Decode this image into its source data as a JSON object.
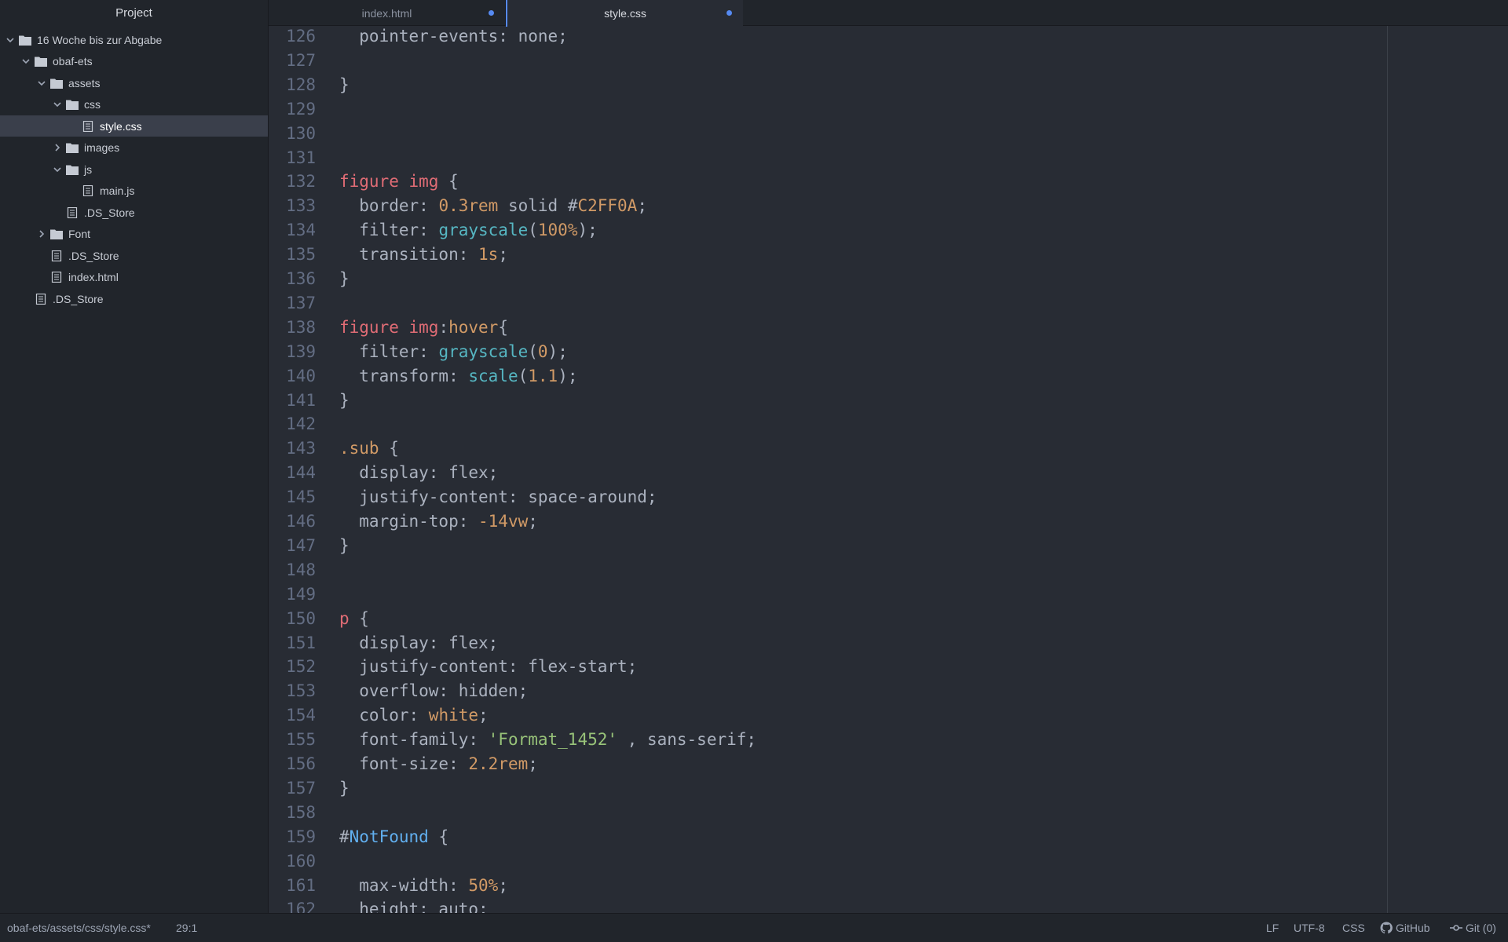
{
  "sidebar": {
    "title": "Project",
    "tree": [
      {
        "label": "16 Woche bis zur Abgabe",
        "type": "folder",
        "expanded": true,
        "depth": 0
      },
      {
        "label": "obaf-ets",
        "type": "folder",
        "expanded": true,
        "depth": 1
      },
      {
        "label": "assets",
        "type": "folder",
        "expanded": true,
        "depth": 2
      },
      {
        "label": "css",
        "type": "folder",
        "expanded": true,
        "depth": 3
      },
      {
        "label": "style.css",
        "type": "file",
        "depth": 4,
        "selected": true
      },
      {
        "label": "images",
        "type": "folder",
        "expanded": false,
        "depth": 3
      },
      {
        "label": "js",
        "type": "folder",
        "expanded": true,
        "depth": 3
      },
      {
        "label": "main.js",
        "type": "file",
        "depth": 4
      },
      {
        "label": ".DS_Store",
        "type": "file",
        "depth": 3
      },
      {
        "label": "Font",
        "type": "folder",
        "expanded": false,
        "depth": 2
      },
      {
        "label": ".DS_Store",
        "type": "file",
        "depth": 2
      },
      {
        "label": "index.html",
        "type": "file",
        "depth": 2
      },
      {
        "label": ".DS_Store",
        "type": "file",
        "depth": 1
      }
    ]
  },
  "tabs": [
    {
      "label": "index.html",
      "active": false,
      "modified": true
    },
    {
      "label": "style.css",
      "active": true,
      "modified": true
    }
  ],
  "editor": {
    "lines": [
      {
        "n": "126",
        "tokens": [
          {
            "t": "  pointer-events: none;",
            "c": ""
          }
        ]
      },
      {
        "n": "127",
        "tokens": []
      },
      {
        "n": "128",
        "tokens": [
          {
            "t": "}",
            "c": ""
          }
        ]
      },
      {
        "n": "129",
        "tokens": []
      },
      {
        "n": "130",
        "tokens": []
      },
      {
        "n": "131",
        "tokens": []
      },
      {
        "n": "132",
        "tokens": [
          {
            "t": "figure img",
            "c": "t-sel"
          },
          {
            "t": " {",
            "c": ""
          }
        ]
      },
      {
        "n": "133",
        "tokens": [
          {
            "t": "  border: ",
            "c": ""
          },
          {
            "t": "0.3rem",
            "c": "t-num"
          },
          {
            "t": " solid ",
            "c": ""
          },
          {
            "t": "#",
            "c": ""
          },
          {
            "t": "C2FF0A",
            "c": "t-num"
          },
          {
            "t": ";",
            "c": ""
          }
        ]
      },
      {
        "n": "134",
        "tokens": [
          {
            "t": "  filter: ",
            "c": ""
          },
          {
            "t": "grayscale",
            "c": "t-fn"
          },
          {
            "t": "(",
            "c": ""
          },
          {
            "t": "100%",
            "c": "t-num"
          },
          {
            "t": ");",
            "c": ""
          }
        ]
      },
      {
        "n": "135",
        "tokens": [
          {
            "t": "  transition: ",
            "c": ""
          },
          {
            "t": "1s",
            "c": "t-num"
          },
          {
            "t": ";",
            "c": ""
          }
        ]
      },
      {
        "n": "136",
        "tokens": [
          {
            "t": "}",
            "c": ""
          }
        ]
      },
      {
        "n": "137",
        "tokens": []
      },
      {
        "n": "138",
        "tokens": [
          {
            "t": "figure img",
            "c": "t-sel"
          },
          {
            "t": ":",
            "c": ""
          },
          {
            "t": "hover",
            "c": "t-cls"
          },
          {
            "t": "{",
            "c": ""
          }
        ]
      },
      {
        "n": "139",
        "tokens": [
          {
            "t": "  filter: ",
            "c": ""
          },
          {
            "t": "grayscale",
            "c": "t-fn"
          },
          {
            "t": "(",
            "c": ""
          },
          {
            "t": "0",
            "c": "t-num"
          },
          {
            "t": ");",
            "c": ""
          }
        ]
      },
      {
        "n": "140",
        "tokens": [
          {
            "t": "  transform: ",
            "c": ""
          },
          {
            "t": "scale",
            "c": "t-fn"
          },
          {
            "t": "(",
            "c": ""
          },
          {
            "t": "1.1",
            "c": "t-num"
          },
          {
            "t": ");",
            "c": ""
          }
        ]
      },
      {
        "n": "141",
        "tokens": [
          {
            "t": "}",
            "c": ""
          }
        ]
      },
      {
        "n": "142",
        "tokens": []
      },
      {
        "n": "143",
        "tokens": [
          {
            "t": ".sub",
            "c": "t-cls"
          },
          {
            "t": " {",
            "c": ""
          }
        ]
      },
      {
        "n": "144",
        "tokens": [
          {
            "t": "  display: flex;",
            "c": ""
          }
        ]
      },
      {
        "n": "145",
        "tokens": [
          {
            "t": "  justify-content: space-around;",
            "c": ""
          }
        ]
      },
      {
        "n": "146",
        "tokens": [
          {
            "t": "  margin-top: ",
            "c": ""
          },
          {
            "t": "-14vw",
            "c": "t-num"
          },
          {
            "t": ";",
            "c": ""
          }
        ]
      },
      {
        "n": "147",
        "tokens": [
          {
            "t": "}",
            "c": ""
          }
        ]
      },
      {
        "n": "148",
        "tokens": []
      },
      {
        "n": "149",
        "tokens": []
      },
      {
        "n": "150",
        "tokens": [
          {
            "t": "p",
            "c": "t-sel"
          },
          {
            "t": " {",
            "c": ""
          }
        ]
      },
      {
        "n": "151",
        "tokens": [
          {
            "t": "  display: flex;",
            "c": ""
          }
        ]
      },
      {
        "n": "152",
        "tokens": [
          {
            "t": "  justify-content: flex-start;",
            "c": ""
          }
        ]
      },
      {
        "n": "153",
        "tokens": [
          {
            "t": "  overflow: hidden;",
            "c": ""
          }
        ]
      },
      {
        "n": "154",
        "tokens": [
          {
            "t": "  color: ",
            "c": ""
          },
          {
            "t": "white",
            "c": "t-kw"
          },
          {
            "t": ";",
            "c": ""
          }
        ]
      },
      {
        "n": "155",
        "tokens": [
          {
            "t": "  font-family: ",
            "c": ""
          },
          {
            "t": "'Format_1452'",
            "c": "t-str"
          },
          {
            "t": " , sans-serif;",
            "c": ""
          }
        ]
      },
      {
        "n": "156",
        "tokens": [
          {
            "t": "  font-size: ",
            "c": ""
          },
          {
            "t": "2.2rem",
            "c": "t-num"
          },
          {
            "t": ";",
            "c": ""
          }
        ]
      },
      {
        "n": "157",
        "tokens": [
          {
            "t": "}",
            "c": ""
          }
        ]
      },
      {
        "n": "158",
        "tokens": []
      },
      {
        "n": "159",
        "tokens": [
          {
            "t": "#",
            "c": ""
          },
          {
            "t": "NotFound",
            "c": "t-id"
          },
          {
            "t": " {",
            "c": ""
          }
        ]
      },
      {
        "n": "160",
        "tokens": []
      },
      {
        "n": "161",
        "tokens": [
          {
            "t": "  max-width: ",
            "c": ""
          },
          {
            "t": "50%",
            "c": "t-num"
          },
          {
            "t": ";",
            "c": ""
          }
        ]
      },
      {
        "n": "162",
        "tokens": [
          {
            "t": "  height: auto;",
            "c": ""
          }
        ]
      }
    ]
  },
  "statusbar": {
    "path": "obaf-ets/assets/css/style.css*",
    "cursor": "29:1",
    "line_ending": "LF",
    "encoding": "UTF-8",
    "grammar": "CSS",
    "github": "GitHub",
    "git": "Git (0)"
  },
  "colors": {
    "background": "#282c34",
    "panel": "#21252b",
    "accent": "#568af2"
  }
}
